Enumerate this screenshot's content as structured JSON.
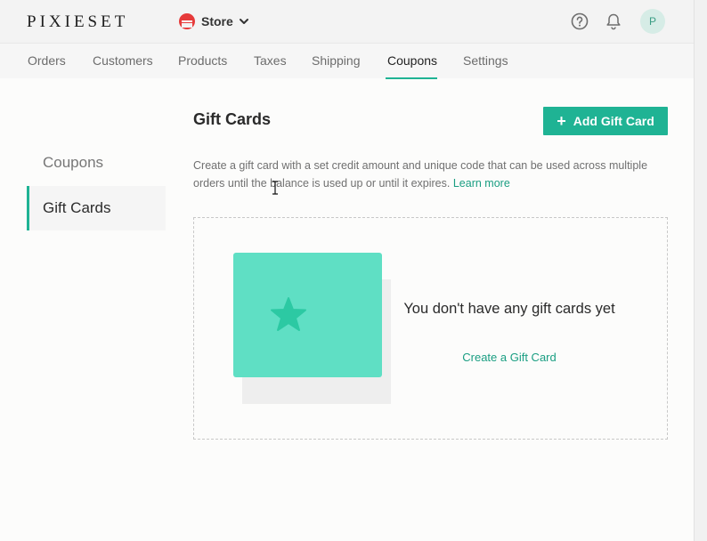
{
  "header": {
    "logo": "PIXIESET",
    "store_label": "Store",
    "avatar_initial": "P"
  },
  "nav": {
    "tabs": [
      {
        "label": "Orders"
      },
      {
        "label": "Customers"
      },
      {
        "label": "Products"
      },
      {
        "label": "Taxes"
      },
      {
        "label": "Shipping"
      },
      {
        "label": "Coupons"
      },
      {
        "label": "Settings"
      }
    ],
    "active_tab": "Coupons"
  },
  "sidebar": {
    "items": [
      {
        "label": "Coupons"
      },
      {
        "label": "Gift Cards"
      }
    ],
    "active_item": "Gift Cards"
  },
  "main": {
    "title": "Gift Cards",
    "add_button_label": "Add Gift Card",
    "description": "Create a gift card with a set credit amount and unique code that can be used across multiple orders until the balance is used up or until it expires.",
    "learn_more": "Learn more",
    "empty_state": {
      "title": "You don't have any gift cards yet",
      "create_link": "Create a Gift Card"
    }
  },
  "colors": {
    "accent": "#1fb394",
    "card_fill": "#5fdfc4",
    "star_fill": "#2cc9a3",
    "store_icon": "#e63a3a"
  },
  "icons": [
    "store-icon",
    "chevron-down-icon",
    "help-icon",
    "bell-icon",
    "plus-icon",
    "star-icon",
    "text-cursor-icon"
  ]
}
